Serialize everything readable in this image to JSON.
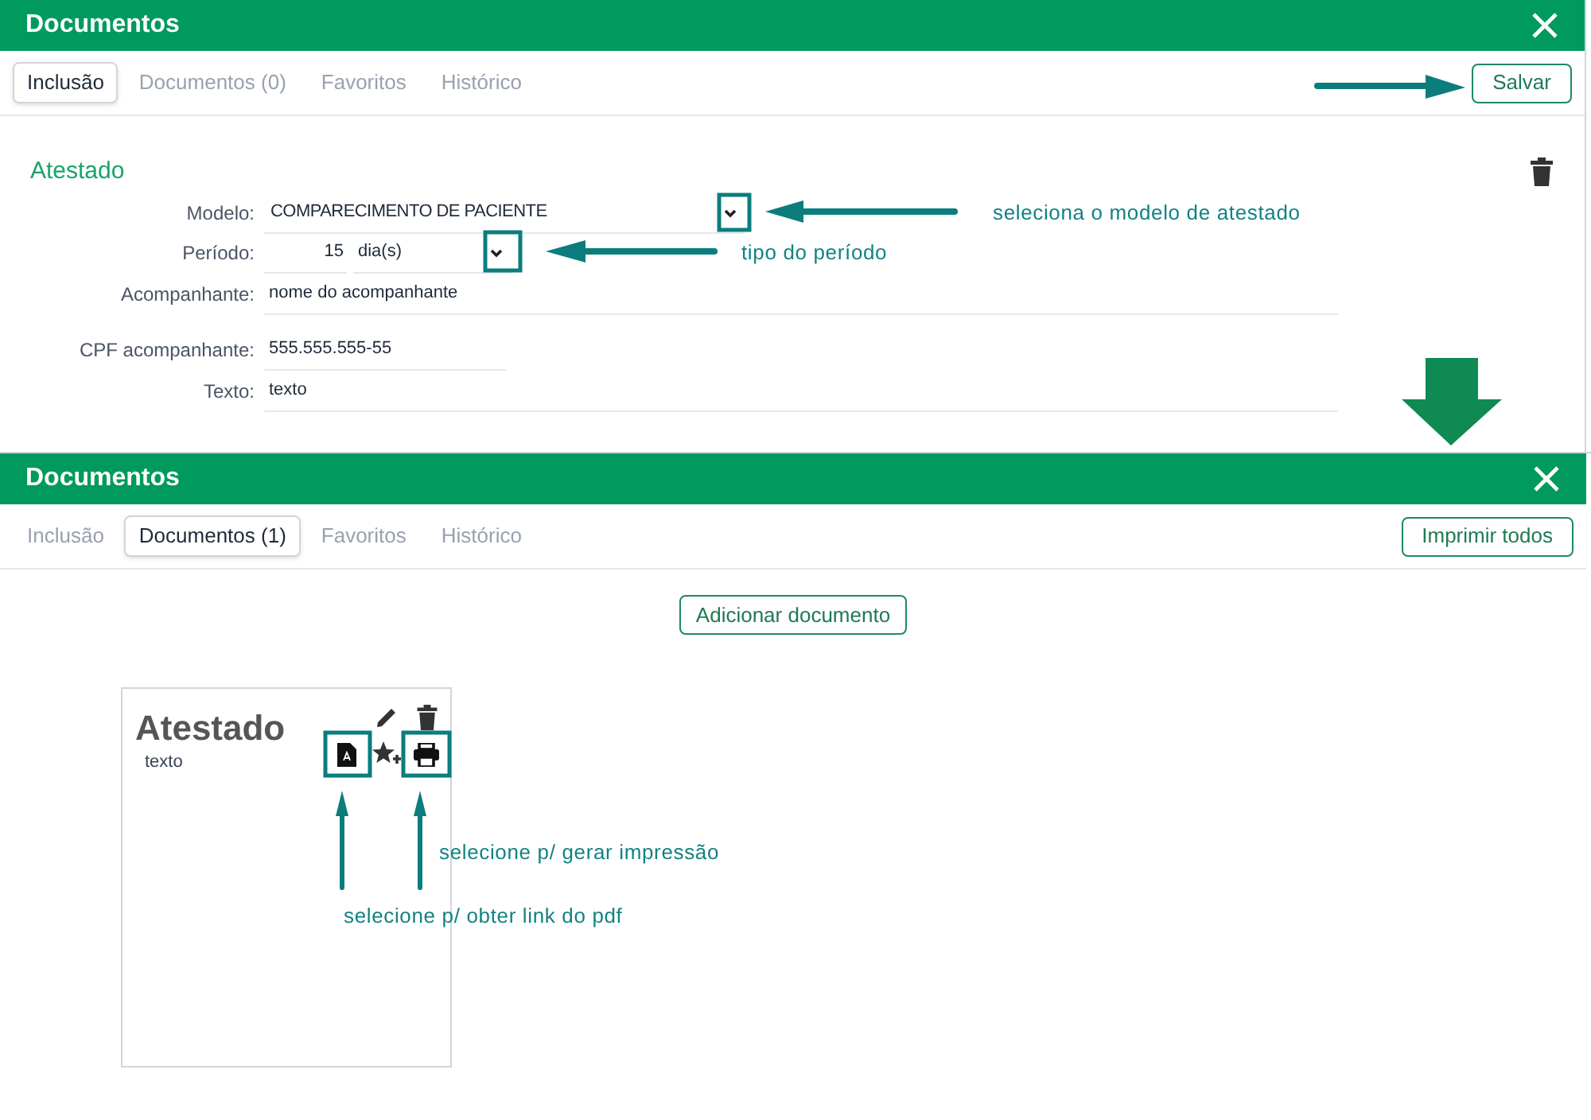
{
  "form_panel": {
    "title": "Documentos",
    "tabs": [
      {
        "label": "Inclusão",
        "selected": true
      },
      {
        "label": "Documentos (0)",
        "selected": false
      },
      {
        "label": "Favoritos",
        "selected": false
      },
      {
        "label": "Histórico",
        "selected": false
      }
    ],
    "action_button": "Salvar",
    "section_title": "Atestado",
    "fields": [
      {
        "kind": "select",
        "label": "Modelo:",
        "value": "COMPARECIMENTO DE PACIENTE"
      },
      {
        "kind": "period",
        "label": "Período:",
        "value": "15",
        "unit": "dia(s)"
      },
      {
        "kind": "text",
        "label": "Acompanhante:",
        "value": "nome do acompanhante"
      },
      {
        "kind": "short",
        "label": "CPF acompanhante:",
        "value": "555.555.555-55"
      },
      {
        "kind": "text",
        "label": "Texto:",
        "value": "texto"
      }
    ]
  },
  "list_panel": {
    "title": "Documentos",
    "tabs": [
      {
        "label": "Inclusão",
        "selected": false
      },
      {
        "label": "Documentos (1)",
        "selected": true
      },
      {
        "label": "Favoritos",
        "selected": false
      },
      {
        "label": "Histórico",
        "selected": false
      }
    ],
    "action_button": "Imprimir todos",
    "add_button": "Adicionar documento",
    "documents": [
      {
        "title": "Atestado",
        "text": "texto"
      }
    ]
  },
  "annotations": [
    {
      "text": "seleciona o modelo de atestado"
    },
    {
      "text": "tipo do período"
    },
    {
      "text": "selecione p/ gerar impressão"
    },
    {
      "text": "selecione p/ obter link do pdf"
    }
  ]
}
